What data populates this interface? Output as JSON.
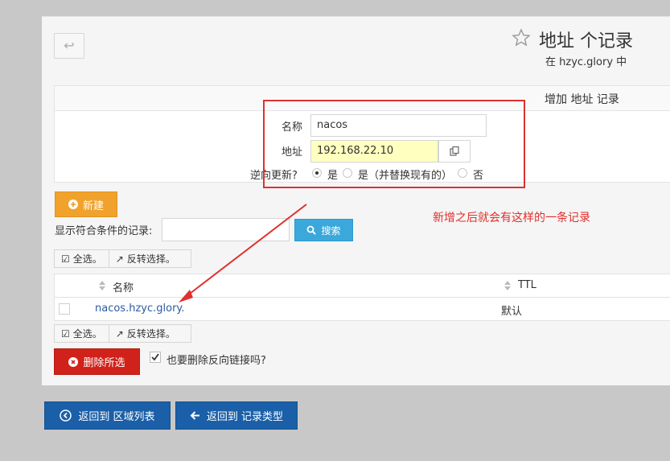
{
  "header": {
    "title": "地址 个记录",
    "subtitle": "在 hzyc.glory 中",
    "back_icon": "undo-arrow-icon",
    "star_icon": "star-outline-icon"
  },
  "form": {
    "header": "增加 地址 记录",
    "name_label": "名称",
    "name_value": "nacos",
    "address_label": "地址",
    "address_value": "192.168.22.10",
    "reverse_label": "逆向更新?",
    "options": [
      "是",
      "是（并替换现有的）",
      "否"
    ],
    "selected_option": "是"
  },
  "toolbar": {
    "new_label": "新建",
    "filter_label": "显示符合条件的记录:",
    "filter_value": "",
    "search_label": "搜索",
    "select_all": "全选。",
    "invert_select": "反转选择。"
  },
  "table": {
    "columns": [
      "名称",
      "TTL"
    ],
    "rows": [
      {
        "name": "nacos.hzyc.glory.",
        "ttl": "默认"
      }
    ]
  },
  "delete": {
    "label": "删除所选",
    "also_delete_label": "也要删除反向链接吗?",
    "also_delete_checked": true
  },
  "annotation": {
    "text": "新增之后就会有这样的一条记录",
    "color": "#e0302a"
  },
  "nav": {
    "back_to_zones": "返回到 区域列表",
    "back_to_types": "返回到 记录类型"
  },
  "colors": {
    "orange": "#f0a22c",
    "blue": "#3aa8db",
    "red": "#d0221a",
    "navy": "#1a5fa8",
    "highlight": "#ffffc0"
  }
}
